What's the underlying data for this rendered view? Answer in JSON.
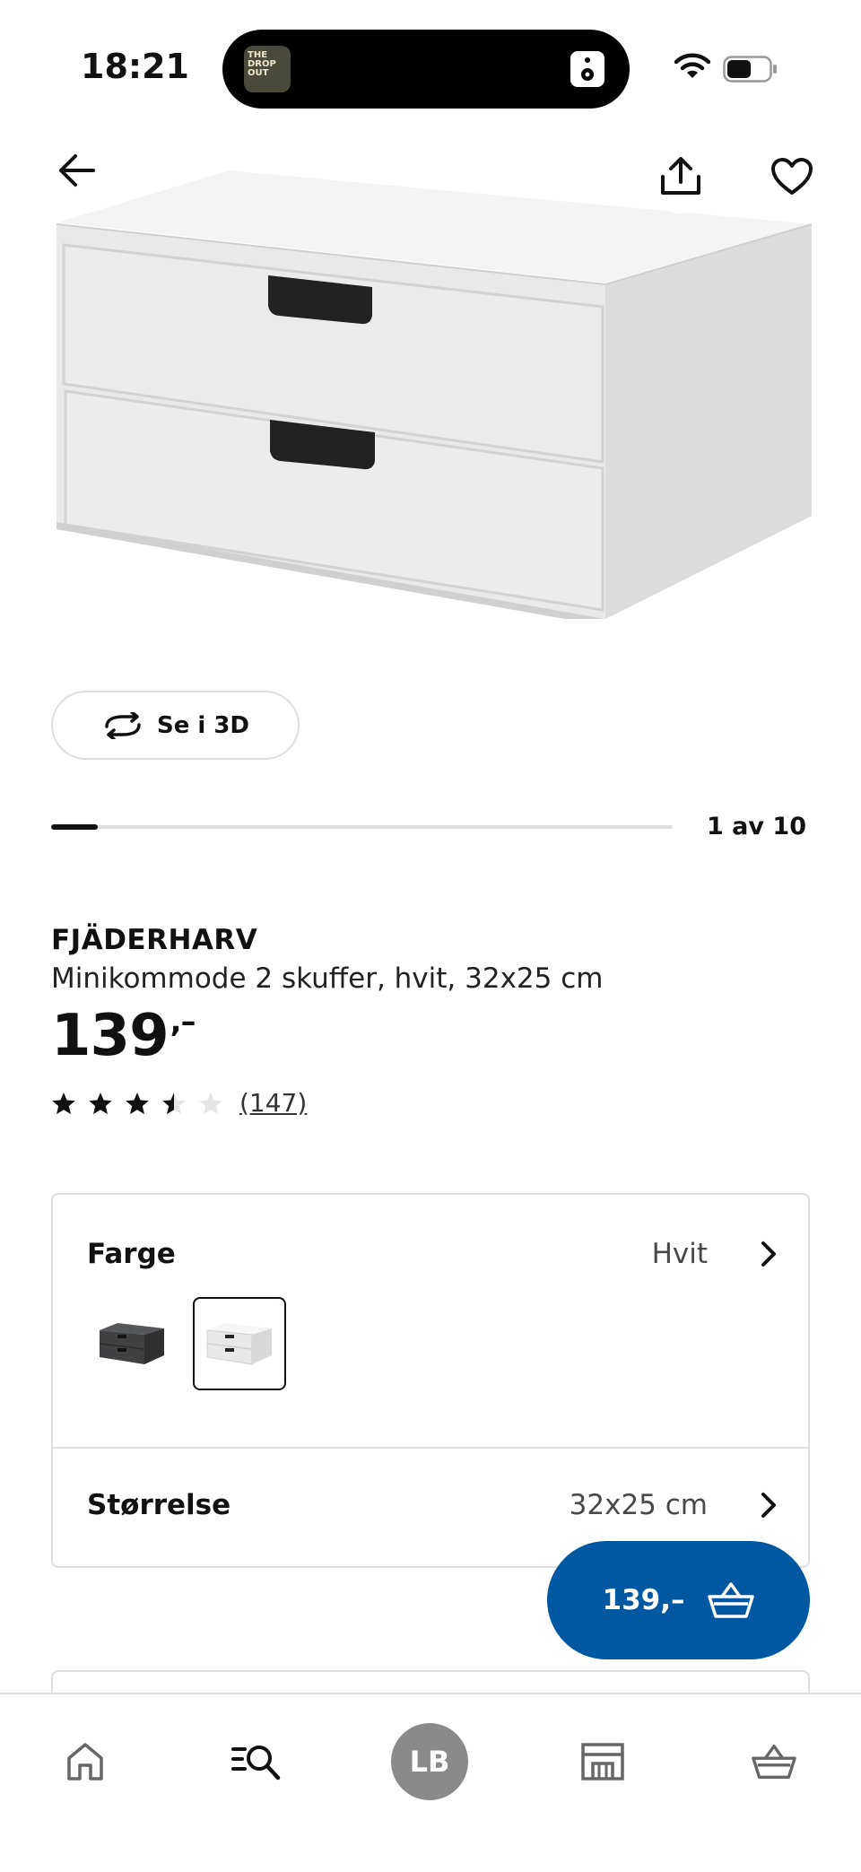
{
  "status_bar": {
    "time": "18:21",
    "now_playing_art": "THE DROP OUT"
  },
  "hero": {
    "back_icon": "arrow-left-icon",
    "share_icon": "share-icon",
    "favorite_icon": "heart-icon",
    "image_alt": "white two-drawer mini chest"
  },
  "view_3d": {
    "label": "Se i 3D",
    "icon": "rotate-3d-icon"
  },
  "carousel": {
    "position_label": "1 av 10",
    "current": 1,
    "total": 10
  },
  "product": {
    "brand": "FJÄDERHARV",
    "description": "Minikommode 2 skuffer, hvit, 32x25 cm",
    "price": "139",
    "price_suffix": ",–",
    "rating_value": 3.5,
    "rating_max": 5,
    "review_count": "(147)"
  },
  "options": {
    "color": {
      "label": "Farge",
      "value": "Hvit",
      "swatches": [
        {
          "name": "dark-grey",
          "color": "#3f4143",
          "selected": false
        },
        {
          "name": "white",
          "color": "#f2f2f2",
          "selected": true
        }
      ]
    },
    "size": {
      "label": "Størrelse",
      "value": "32x25 cm"
    }
  },
  "cart_fab": {
    "label": "139,–",
    "icon": "basket-icon"
  },
  "bottom_nav": {
    "items": [
      {
        "name": "home",
        "icon": "home-icon"
      },
      {
        "name": "search",
        "icon": "search-list-icon"
      },
      {
        "name": "profile",
        "avatar_initials": "LB"
      },
      {
        "name": "stores",
        "icon": "store-icon"
      },
      {
        "name": "cart",
        "icon": "basket-icon"
      }
    ]
  },
  "colors": {
    "accent": "#0058a3",
    "text": "#111111",
    "border": "#dfdfdf",
    "avatar_bg": "#8a8a8a"
  }
}
